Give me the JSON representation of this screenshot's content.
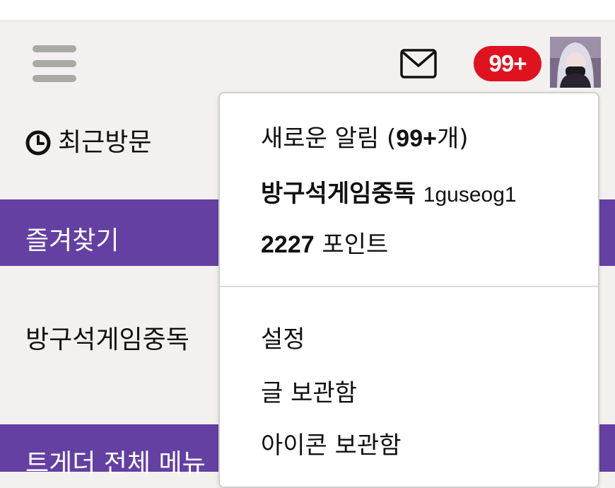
{
  "header": {
    "notification_badge": "99+",
    "colors": {
      "badge": "#e0121f",
      "accent_bar": "#6440a2",
      "menu_icon": "#a9aaa3"
    },
    "icons": [
      "hamburger-menu-icon",
      "mail-icon"
    ]
  },
  "sidebar": {
    "recent_label": "최근방문",
    "favorites_label": "즐겨찾기",
    "community_label": "방구석게임중독",
    "all_menu_label": "트게더 전체 메뉴"
  },
  "dropdown": {
    "notice_prefix": "새로운 알림 (",
    "notice_count": "99+",
    "notice_suffix": "개)",
    "nickname": "방구석게임중독",
    "user_id": "1guseog1",
    "points_value": "2227",
    "points_label": "포인트",
    "settings_label": "설정",
    "saved_posts_label": "글 보관함",
    "saved_icons_label": "아이콘 보관함"
  }
}
